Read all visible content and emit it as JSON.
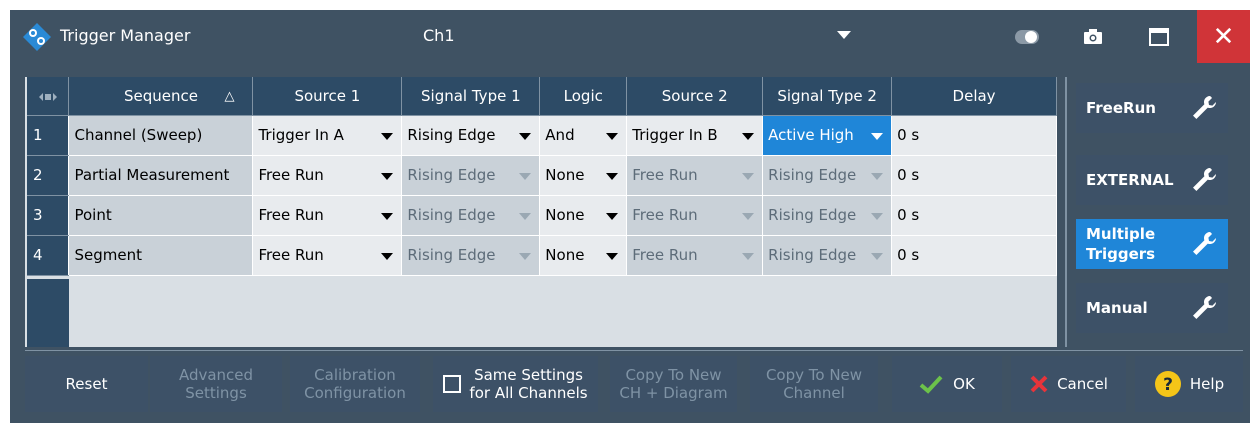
{
  "window": {
    "title": "Trigger Manager",
    "channel": "Ch1",
    "close_glyph": "✕",
    "icons": [
      "rs-logo-icon",
      "chevron-down-icon",
      "toggle-icon",
      "camera-icon",
      "maximize-icon",
      "close-icon"
    ]
  },
  "table": {
    "headers": {
      "sequence": "Sequence",
      "source1": "Source 1",
      "signal_type1": "Signal Type 1",
      "logic": "Logic",
      "source2": "Source 2",
      "signal_type2": "Signal Type 2",
      "delay": "Delay"
    },
    "sort_glyph": "△",
    "rows": [
      {
        "num": "1",
        "sequence": "Channel (Sweep)",
        "source1": "Trigger In A",
        "signal_type1": "Rising Edge",
        "logic": "And",
        "source2": "Trigger In B",
        "signal_type2": "Active High",
        "delay": "0 s"
      },
      {
        "num": "2",
        "sequence": "Partial Measurement",
        "source1": "Free Run",
        "signal_type1": "Rising Edge",
        "logic": "None",
        "source2": "Free Run",
        "signal_type2": "Rising Edge",
        "delay": "0 s"
      },
      {
        "num": "3",
        "sequence": "Point",
        "source1": "Free Run",
        "signal_type1": "Rising Edge",
        "logic": "None",
        "source2": "Free Run",
        "signal_type2": "Rising Edge",
        "delay": "0 s"
      },
      {
        "num": "4",
        "sequence": "Segment",
        "source1": "Free Run",
        "signal_type1": "Rising Edge",
        "logic": "None",
        "source2": "Free Run",
        "signal_type2": "Rising Edge",
        "delay": "0 s"
      }
    ]
  },
  "side_buttons": {
    "freerun": "FreeRun",
    "external": "EXTERNAL",
    "multiple_line1": "Multiple",
    "multiple_line2": "Triggers",
    "manual": "Manual",
    "active": "Multiple Triggers"
  },
  "bottom": {
    "reset": "Reset",
    "advanced_line1": "Advanced",
    "advanced_line2": "Settings",
    "calibration_line1": "Calibration",
    "calibration_line2": "Configuration",
    "same_line1": "Same Settings",
    "same_line2": "for All Channels",
    "same_checked": false,
    "copy_new_diagram_line1": "Copy To New",
    "copy_new_diagram_line2": "CH + Diagram",
    "copy_new_channel_line1": "Copy To New",
    "copy_new_channel_line2": "Channel",
    "ok": "OK",
    "cancel": "Cancel",
    "help": "Help"
  },
  "colors": {
    "window_bg": "#3f5263",
    "header_bg": "#2d4b66",
    "accent_blue": "#1f86d8",
    "close_red": "#d03438",
    "ok_green": "#6cc24a",
    "cancel_red": "#e8343a",
    "help_yellow": "#f5c518"
  }
}
